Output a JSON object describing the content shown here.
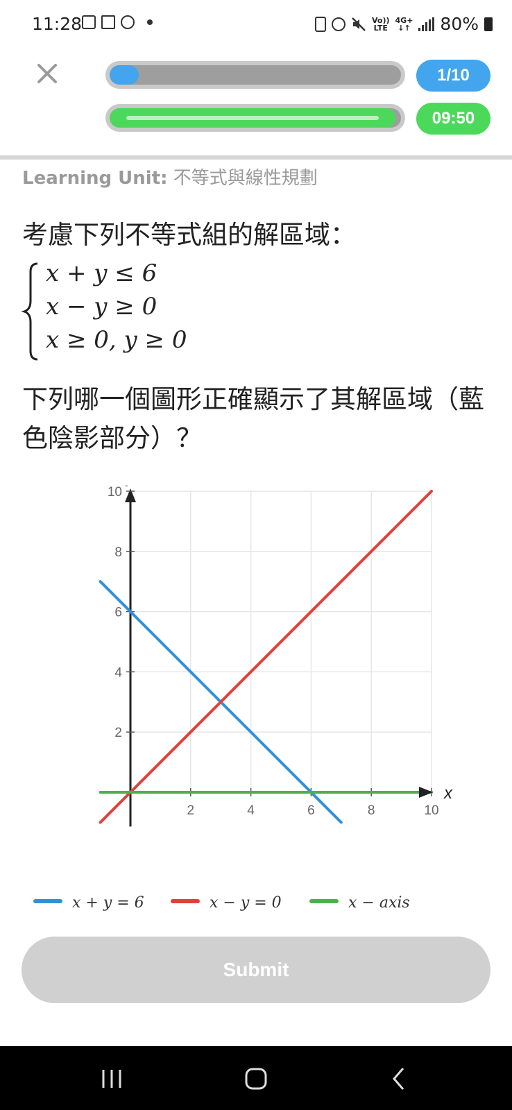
{
  "status_bar": {
    "time": "11:28",
    "network_top": "Vo))",
    "network_bottom": "LTE",
    "data_top": "4G+",
    "battery": "80%"
  },
  "quiz": {
    "progress_label": "1/10",
    "progress_fraction": 0.1,
    "timer_label": "09:50",
    "timer_fraction": 0.98
  },
  "learning_unit": {
    "prefix": "Learning Unit:",
    "name": "不等式與線性規劃"
  },
  "question": {
    "title": "考慮下列不等式組的解區域：",
    "equations": [
      "x + y ≤ 6",
      "x − y ≥ 0",
      "x ≥ 0, y ≥ 0"
    ],
    "prompt": "下列哪一個圖形正確顯示了其解區域（藍色陰影部分）？"
  },
  "chart_data": {
    "type": "line",
    "xlabel": "x",
    "ylabel": "y",
    "xlim": [
      -1,
      10
    ],
    "ylim": [
      -1,
      10
    ],
    "x_ticks": [
      2,
      4,
      6,
      8,
      10
    ],
    "y_ticks": [
      2,
      4,
      6,
      8,
      10
    ],
    "grid": true,
    "legend_position": "bottom",
    "series": [
      {
        "name": "x + y = 6",
        "color": "#2f8fdc",
        "points": [
          [
            -1,
            7
          ],
          [
            7,
            -1
          ]
        ]
      },
      {
        "name": "x − y = 0",
        "color": "#e0403a",
        "points": [
          [
            -1,
            -1
          ],
          [
            10,
            10
          ]
        ]
      },
      {
        "name": "x − axis",
        "color": "#4caf50",
        "points": [
          [
            -1,
            0
          ],
          [
            10,
            0
          ]
        ]
      }
    ]
  },
  "submit_label": "Submit",
  "icons": {
    "close": "close-icon",
    "nav_recent": "recent-apps-icon",
    "nav_home": "home-icon",
    "nav_back": "back-icon"
  }
}
